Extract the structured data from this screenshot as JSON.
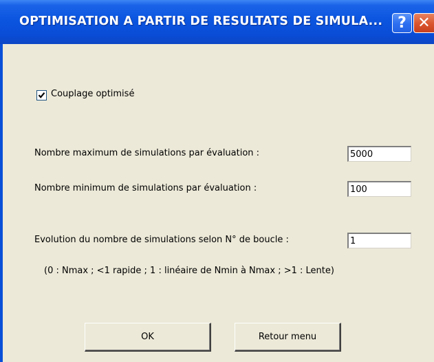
{
  "window": {
    "title": "OPTIMISATION A PARTIR DE RESULTATS DE SIMULA...",
    "help_glyph": "?",
    "close_glyph": "✕"
  },
  "options": {
    "coupling_label": "Couplage optimisé",
    "coupling_checked": true
  },
  "fields": {
    "max_label": "Nombre maximum de simulations par évaluation :",
    "max_value": "5000",
    "min_label": "Nombre minimum de simulations par évaluation :",
    "min_value": "100",
    "evolution_label": "Evolution du nombre de simulations selon N° de boucle :",
    "evolution_value": "1",
    "hint": "(0 : Nmax ; <1 rapide ; 1 : linéaire de Nmin à Nmax ; >1 : Lente)"
  },
  "buttons": {
    "ok_label": "OK",
    "back_label": "Retour menu"
  },
  "colors": {
    "titlebar": "#0a4cd6",
    "client": "#ece9d8",
    "close_button": "#d9542e",
    "checkmark": "#000000"
  },
  "icons": {
    "help": "help-icon",
    "close": "close-icon",
    "check": "checkmark-icon"
  }
}
